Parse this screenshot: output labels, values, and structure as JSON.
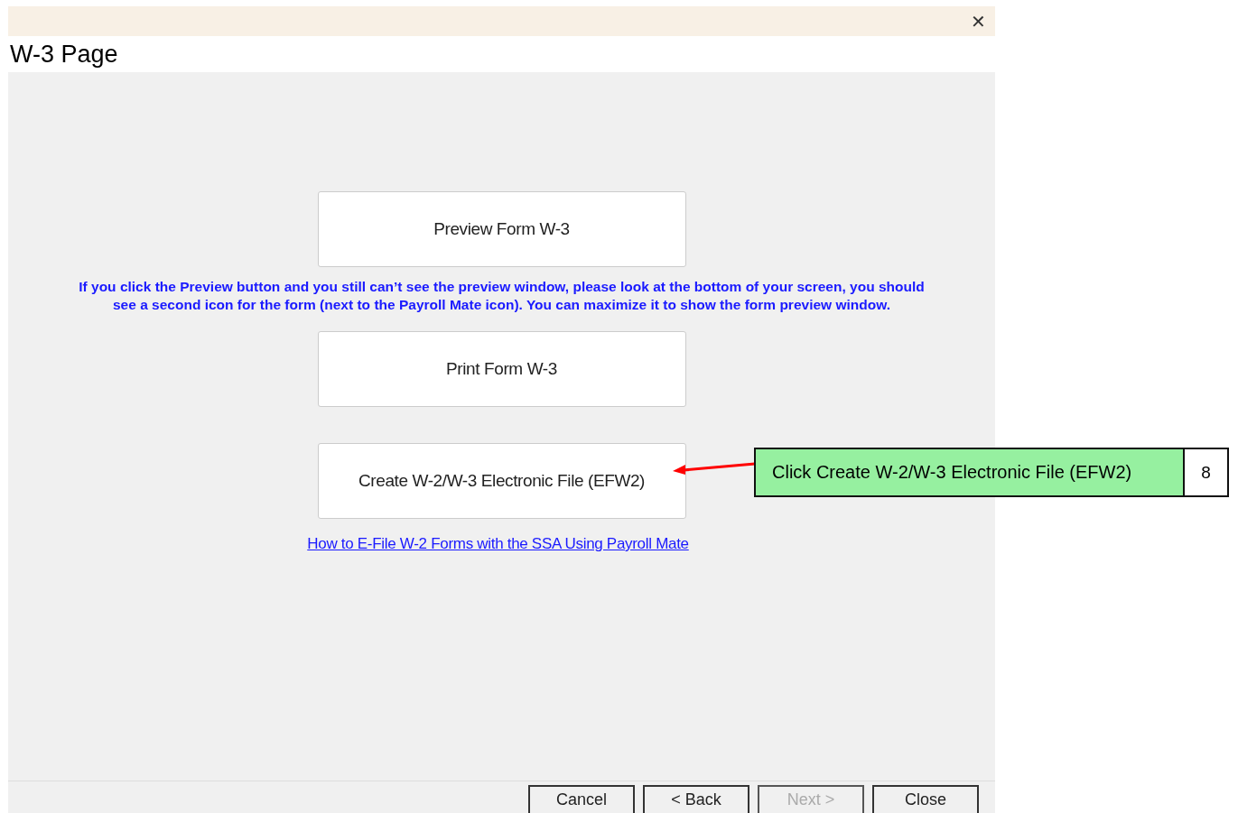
{
  "window": {
    "close_icon": "✕",
    "title": "W-3 Page"
  },
  "actions": [
    {
      "label": "Preview Form W-3"
    }
  ],
  "note": "If you click the Preview button and you still can’t see the preview window, please look at the bottom of your screen, you should see a second icon for the form (next to the Payroll Mate icon). You can maximize it to show the form preview window.",
  "actions_2": [
    {
      "label": "Print Form W-3"
    },
    {
      "label": "Create W-2/W-3 Electronic File (EFW2)"
    }
  ],
  "link": "How to E-File W-2 Forms with the SSA Using Payroll Mate",
  "footer_buttons": [
    {
      "label": "Cancel",
      "disabled": false
    },
    {
      "label": "< Back",
      "disabled": false
    },
    {
      "label": "Next >",
      "disabled": true
    },
    {
      "label": "Close",
      "disabled": false
    }
  ],
  "callout": {
    "text": "Click Create W-2/W-3 Electronic File (EFW2)",
    "step": "8"
  }
}
